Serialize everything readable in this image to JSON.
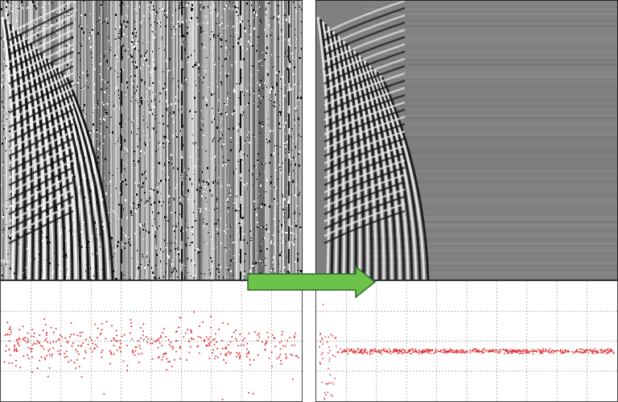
{
  "panels": {
    "left": {
      "state": "before",
      "noise": "high"
    },
    "right": {
      "state": "after",
      "noise": "low"
    }
  },
  "colors": {
    "arrow_fill": "#6cc24a",
    "arrow_stroke": "#2f6b2a",
    "points": "#e0343a",
    "grid": "#9a9a9a",
    "right_background": "#808080"
  },
  "chart_data": [
    {
      "type": "scatter",
      "title": "",
      "xlabel": "",
      "ylabel": "",
      "grid": true,
      "description_values": {
        "center": 0.4,
        "spread": 0.18,
        "outlier_rate": 0.06,
        "count": 420
      }
    },
    {
      "type": "scatter",
      "title": "",
      "xlabel": "",
      "ylabel": "",
      "grid": true,
      "description_values": {
        "center": 0.45,
        "spread": 0.02,
        "outlier_rate": 0.01,
        "count": 600
      }
    }
  ],
  "icons": {
    "transition": "right-arrow-icon"
  }
}
